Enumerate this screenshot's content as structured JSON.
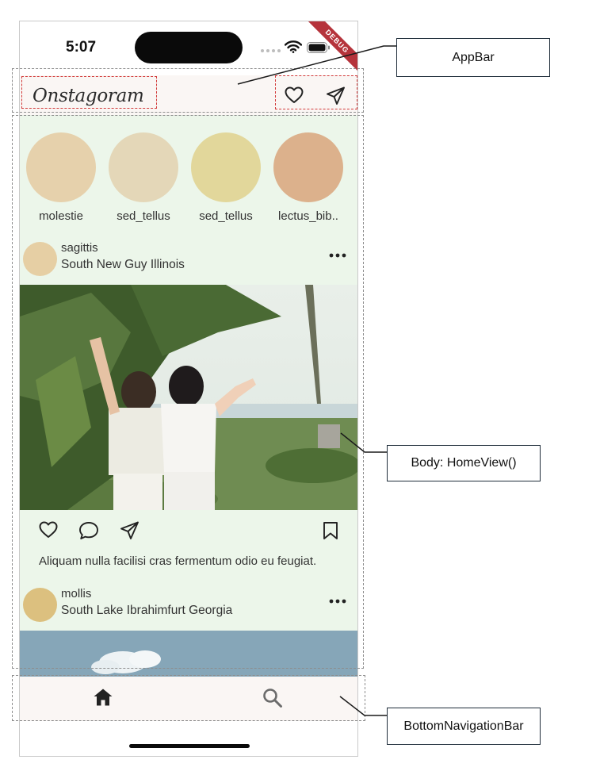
{
  "status_bar": {
    "time": "5:07",
    "debug_label": "DEBUG"
  },
  "app_bar": {
    "logo": "Onstagoram",
    "icons": [
      "heart-icon",
      "send-icon"
    ]
  },
  "stories": [
    {
      "name": "molestie",
      "color": "#e6d1ac"
    },
    {
      "name": "sed_tellus",
      "color": "#e4d7b8"
    },
    {
      "name": "sed_tellus",
      "color": "#e2d79b"
    },
    {
      "name": "lectus_bib..",
      "color": "#dcb18c"
    }
  ],
  "posts": [
    {
      "username": "sagittis",
      "location": "South New Guy Illinois",
      "avatar_color": "#e6cfa4",
      "caption": "Aliquam nulla facilisi cras fermentum odio eu feugiat."
    },
    {
      "username": "mollis",
      "location": "South Lake Ibrahimfurt Georgia",
      "avatar_color": "#dcc07f"
    }
  ],
  "bottom_nav": {
    "icons": [
      "home-icon",
      "search-icon"
    ]
  },
  "annotations": {
    "app_bar": "AppBar",
    "body": "Body: HomeView()",
    "bottom_nav": "BottomNavigationBar"
  },
  "colors": {
    "app_bar_bg": "#faf6f4",
    "body_bg": "#ecf6ea",
    "debug_banner": "#b5333b",
    "dashed_gray": "#8d8d8d",
    "dashed_red": "#d23a3a"
  }
}
